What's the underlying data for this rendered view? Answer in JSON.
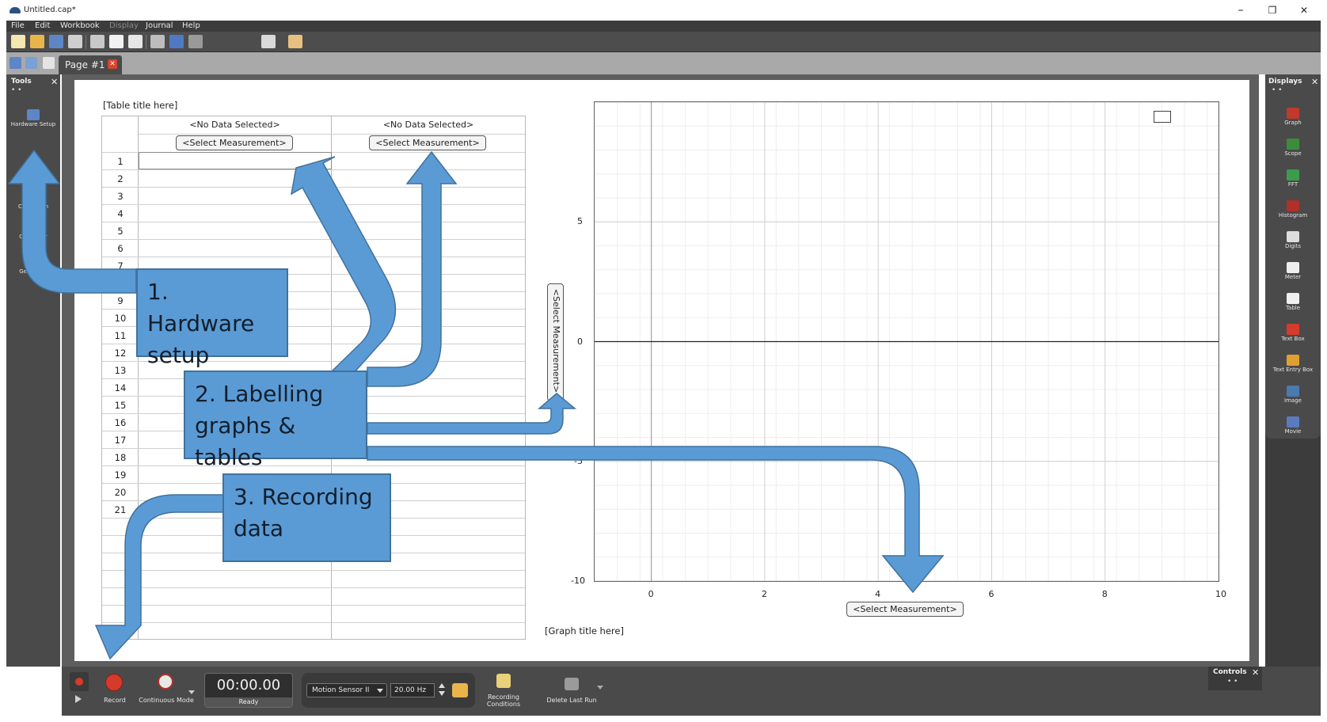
{
  "window": {
    "title": "Untitled.cap*",
    "minimize": "–",
    "restore": "❐",
    "close": "✕"
  },
  "menu": {
    "file": "File",
    "edit": "Edit",
    "workbook": "Workbook",
    "display": "Display",
    "journal": "Journal",
    "help": "Help"
  },
  "page_tab": {
    "label": "Page #1",
    "close": "✕"
  },
  "tools_panel": {
    "title": "Tools",
    "close": "✕",
    "dots": "• •",
    "items": [
      {
        "label": "Hardware Setup",
        "icon": "hardware-setup-icon"
      },
      {
        "label": "Calibration",
        "icon": "calibration-icon"
      },
      {
        "label": "Calculator",
        "icon": "calculator-icon"
      },
      {
        "label": "Signal Generator",
        "icon": "signal-generator-icon"
      }
    ]
  },
  "displays_panel": {
    "title": "Displays",
    "close": "✕",
    "dots": "• •",
    "items": [
      {
        "label": "Graph",
        "icon": "graph-icon",
        "color": "#c0392b"
      },
      {
        "label": "Scope",
        "icon": "scope-icon",
        "color": "#3c8c3c"
      },
      {
        "label": "FFT",
        "icon": "fft-icon",
        "color": "#3c9c4c"
      },
      {
        "label": "Histogram",
        "icon": "histogram-icon",
        "color": "#b0302a"
      },
      {
        "label": "Digits",
        "icon": "digits-icon",
        "color": "#dddddd"
      },
      {
        "label": "Meter",
        "icon": "meter-icon",
        "color": "#eeeeee"
      },
      {
        "label": "Table",
        "icon": "table-icon",
        "color": "#f0f0f0"
      },
      {
        "label": "Text Box",
        "icon": "text-box-icon",
        "color": "#d63a2a"
      },
      {
        "label": "Text Entry Box",
        "icon": "text-entry-box-icon",
        "color": "#e0a030"
      },
      {
        "label": "Image",
        "icon": "image-icon",
        "color": "#4a7ab0"
      },
      {
        "label": "Movie",
        "icon": "movie-icon",
        "color": "#5a7ac0"
      }
    ]
  },
  "table": {
    "title": "[Table title here]",
    "columns": [
      {
        "header": "<No Data Selected>",
        "measurement": "<Select Measurement>"
      },
      {
        "header": "<No Data Selected>",
        "measurement": "<Select Measurement>"
      }
    ],
    "row_numbers": [
      "1",
      "2",
      "3",
      "4",
      "5",
      "6",
      "7",
      "8",
      "9",
      "10",
      "11",
      "12",
      "13",
      "14",
      "15",
      "16",
      "17",
      "18",
      "19",
      "20",
      "21"
    ],
    "blank_rows": 7
  },
  "graph": {
    "title": "[Graph title here]",
    "x_measurement": "<Select Measurement>",
    "y_measurement": "<Select Measurement>",
    "x_ticks": [
      "0",
      "2",
      "4",
      "6",
      "8",
      "10"
    ],
    "y_ticks": [
      "5",
      "0",
      "-5",
      "-10"
    ],
    "xlim": [
      -1,
      10
    ],
    "ylim": [
      -10,
      10
    ],
    "grid": true
  },
  "controls": {
    "record": "Record",
    "mode": "Continuous Mode",
    "time": "00:00.00",
    "status": "Ready",
    "sensor": "Motion Sensor II",
    "rate": "20.00 Hz",
    "recording_conditions": "Recording Conditions",
    "delete_last_run": "Delete Last Run",
    "panel_title": "Controls",
    "panel_close": "✕",
    "panel_dots": "• •"
  },
  "callouts": {
    "hardware": "1. Hardware setup",
    "labelling": "2. Labelling graphs & tables",
    "recording": "3. Recording data"
  },
  "colors": {
    "callout_fill": "#5b9bd5",
    "callout_border": "#41719c",
    "panel_bg": "#4a4a4a",
    "record_red": "#d63a2a"
  }
}
